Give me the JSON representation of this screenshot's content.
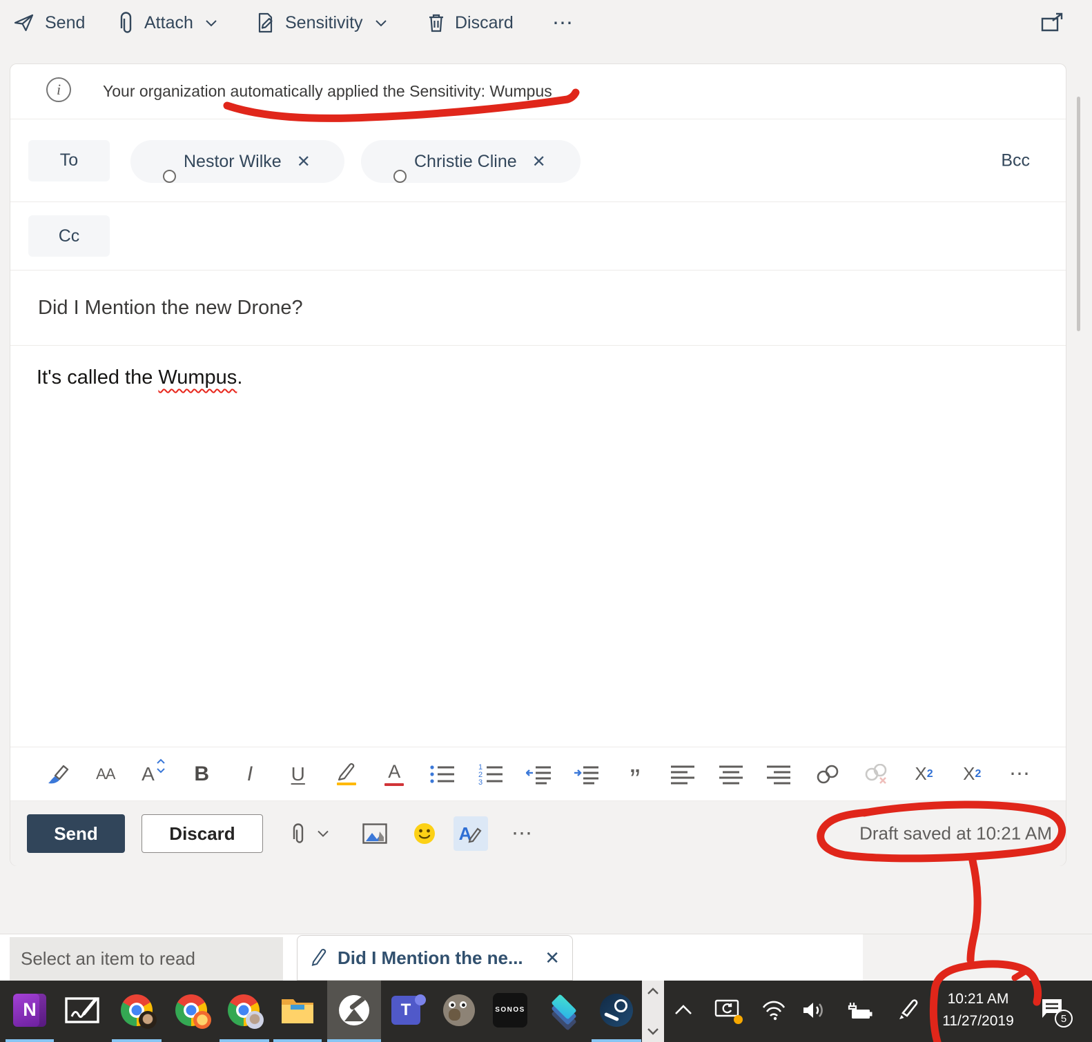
{
  "compose_toolbar": {
    "send_label": "Send",
    "attach_label": "Attach",
    "sensitivity_label": "Sensitivity",
    "discard_label": "Discard"
  },
  "banner": {
    "info_glyph": "i",
    "text": "Your organization automatically applied the Sensitivity: Wumpus"
  },
  "recipients": {
    "to_label": "To",
    "cc_label": "Cc",
    "bcc_label": "Bcc",
    "chips": [
      {
        "name": "Nestor Wilke"
      },
      {
        "name": "Christie Cline"
      }
    ]
  },
  "subject": "Did I Mention the new Drone?",
  "body": {
    "before": "It's called the ",
    "misspelled": "Wumpus",
    "after": "."
  },
  "format_bar": {
    "font": "AA",
    "size_letter": "A",
    "bold": "B",
    "italic": "I",
    "underline": "U",
    "color_letter": "A",
    "quote": "”",
    "sup_base": "X",
    "sup_script": "2",
    "sub_base": "X",
    "sub_script": "2"
  },
  "action_bar": {
    "send_label": "Send",
    "discard_label": "Discard",
    "format_letter": "A",
    "draft_status": "Draft saved at 10:21 AM"
  },
  "reading_pane": {
    "empty_text": "Select an item to read"
  },
  "draft_tab": {
    "title": "Did I Mention the ne..."
  },
  "taskbar": {
    "onenote_letter": "N",
    "teams_letter": "T",
    "sonos_label": "SONOS",
    "clock_time": "10:21 AM",
    "clock_date": "11/27/2019",
    "notification_count": "5"
  },
  "icons": {
    "close": "✕",
    "more": "⋯"
  },
  "colors": {
    "annotation_red": "#e0261a",
    "theme_navy": "#33475b",
    "send_button": "#31455a",
    "taskbar_bg": "#2b2a28",
    "running_underline": "#86c5f3",
    "highlight_yellow": "#ffb900",
    "font_color_red": "#d13438"
  }
}
